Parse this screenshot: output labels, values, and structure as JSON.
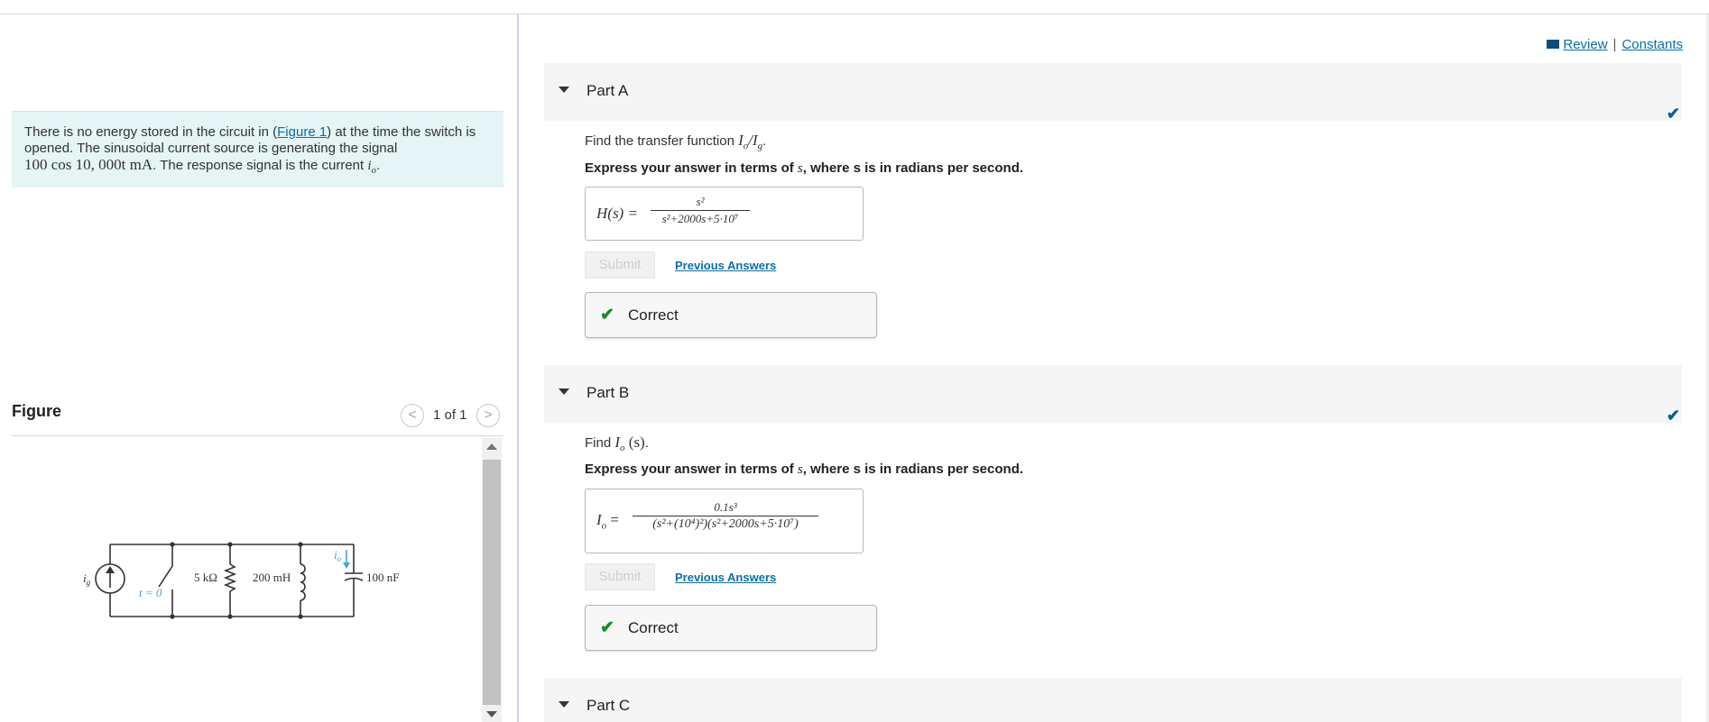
{
  "links": {
    "review": "Review",
    "separator": "|",
    "constants": "Constants"
  },
  "intro": {
    "text_before": "There is no energy stored in the circuit in (",
    "figure_link": "Figure 1",
    "text_after": ") at the time the switch is opened. The sinusoidal current source is generating the signal",
    "signal": "100 cos 10, 000t mA",
    "text_end": ". The response signal is the current ",
    "response_var": "i",
    "response_sub": "o",
    "period": "."
  },
  "figure": {
    "title": "Figure",
    "counter": "1 of 1",
    "prev_glyph": "<",
    "next_glyph": ">",
    "labels": {
      "source": "i",
      "source_sub": "g",
      "switch": "t = 0",
      "resistor": "5 kΩ",
      "inductor": "200 mH",
      "current": "i",
      "current_sub": "o",
      "capacitor": "100 nF"
    }
  },
  "parts": [
    {
      "title": "Part A",
      "prompt_prefix": "Find the transfer function ",
      "prompt_math": "I",
      "prompt_math_sub": "o",
      "prompt_math_slash": "/I",
      "prompt_math_sub2": "g",
      "prompt_end": ".",
      "instr_prefix": "Express your answer in terms of ",
      "instr_var": "s",
      "instr_suffix": ", where s is in radians per second.",
      "answer_lhs": "H(s) =",
      "answer_num": "s²",
      "answer_den": "s²+2000s+5·10⁷",
      "submit": "Submit",
      "previous": "Previous Answers",
      "feedback": "Correct",
      "check": "✔"
    },
    {
      "title": "Part B",
      "prompt_prefix": "Find ",
      "prompt_math": "I",
      "prompt_math_sub": "o",
      "prompt_math_rest": " (s)",
      "prompt_end": ".",
      "instr_prefix": "Express your answer in terms of ",
      "instr_var": "s",
      "instr_suffix": ", where s is in radians per second.",
      "answer_lhs": "I",
      "answer_lhs_sub": "o",
      "answer_eq": " =",
      "answer_num": "0.1s³",
      "answer_den": "(s²+(10⁴)²)(s²+2000s+5·10⁷)",
      "submit": "Submit",
      "previous": "Previous Answers",
      "feedback": "Correct",
      "check": "✔"
    },
    {
      "title": "Part C"
    }
  ],
  "colors": {
    "accent_link": "#0a6fa8",
    "correct_green": "#1a8a2e",
    "check_blue": "#0a5f8c",
    "intro_bg": "#e5f4f4",
    "circuit_blue": "#4aa3d8"
  }
}
